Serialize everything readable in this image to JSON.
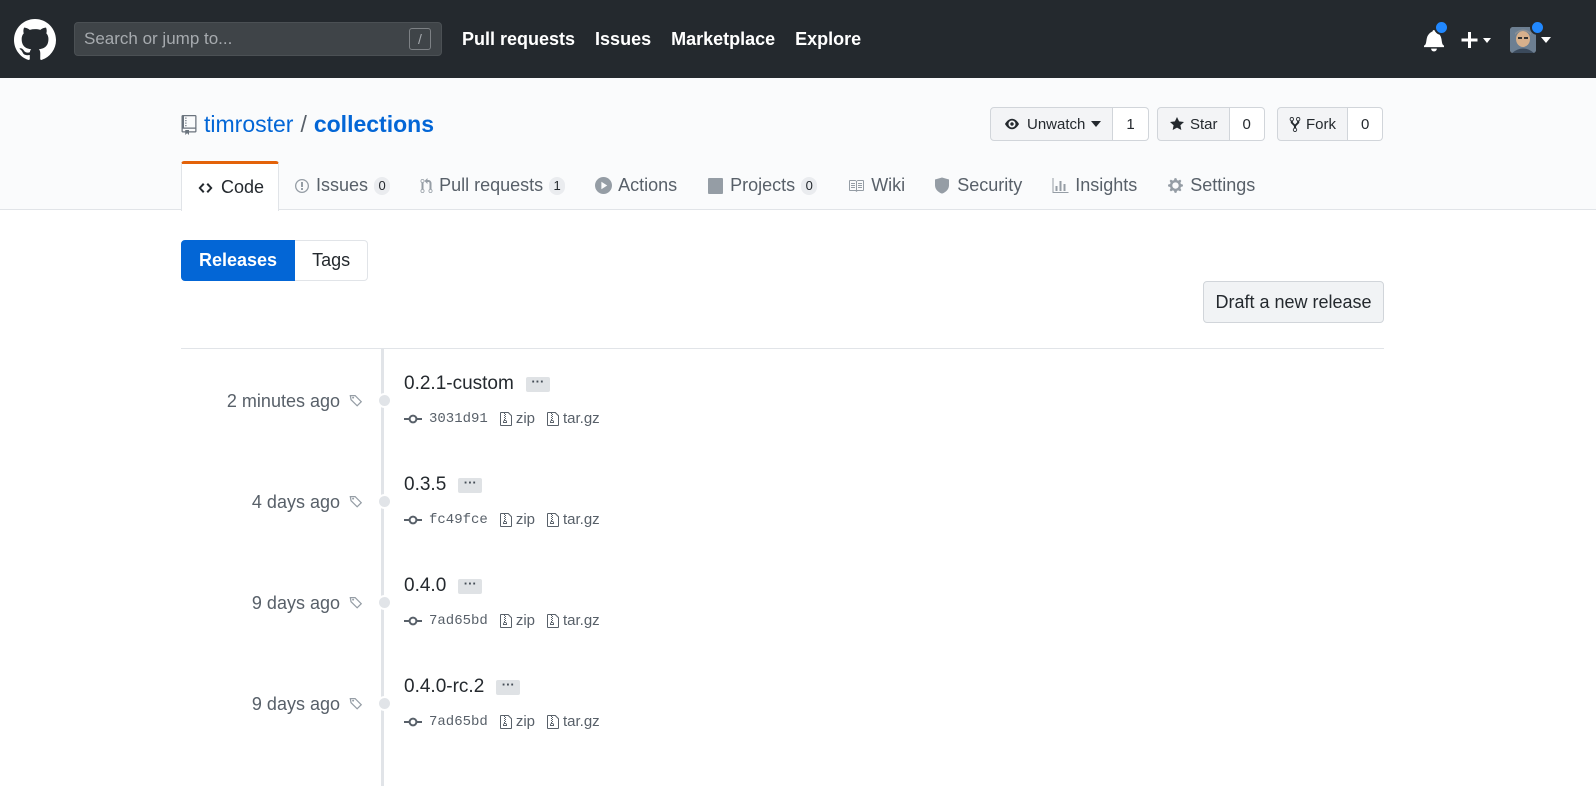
{
  "header": {
    "search_placeholder": "Search or jump to...",
    "search_key": "/",
    "nav": [
      "Pull requests",
      "Issues",
      "Marketplace",
      "Explore"
    ],
    "notification_dot_color": "#2188ff"
  },
  "repo": {
    "owner": "timroster",
    "separator": "/",
    "name": "collections",
    "watch": {
      "label": "Unwatch",
      "count": "1"
    },
    "star": {
      "label": "Star",
      "count": "0"
    },
    "fork": {
      "label": "Fork",
      "count": "0"
    }
  },
  "tabs": [
    {
      "label": "Code",
      "icon": "code-icon",
      "selected": true
    },
    {
      "label": "Issues",
      "icon": "issue-icon",
      "count": "0"
    },
    {
      "label": "Pull requests",
      "icon": "pull-request-icon",
      "count": "1"
    },
    {
      "label": "Actions",
      "icon": "play-icon"
    },
    {
      "label": "Projects",
      "icon": "project-icon",
      "count": "0"
    },
    {
      "label": "Wiki",
      "icon": "book-icon"
    },
    {
      "label": "Security",
      "icon": "shield-icon"
    },
    {
      "label": "Insights",
      "icon": "graph-icon"
    },
    {
      "label": "Settings",
      "icon": "gear-icon"
    }
  ],
  "subnav": {
    "releases": "Releases",
    "tags": "Tags"
  },
  "draft_button": "Draft a new release",
  "releases": [
    {
      "date": "2 minutes ago",
      "tag": "0.2.1-custom",
      "ellipsis": "···",
      "sha": "3031d91",
      "zip": "zip",
      "targz": "tar.gz"
    },
    {
      "date": "4 days ago",
      "tag": "0.3.5",
      "ellipsis": "···",
      "sha": "fc49fce",
      "zip": "zip",
      "targz": "tar.gz"
    },
    {
      "date": "9 days ago",
      "tag": "0.4.0",
      "ellipsis": "···",
      "sha": "7ad65bd",
      "zip": "zip",
      "targz": "tar.gz"
    },
    {
      "date": "9 days ago",
      "tag": "0.4.0-rc.2",
      "ellipsis": "···",
      "sha": "7ad65bd",
      "zip": "zip",
      "targz": "tar.gz"
    }
  ]
}
